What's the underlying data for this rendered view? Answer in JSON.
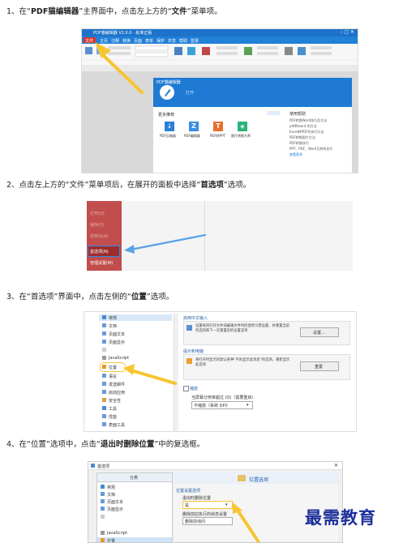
{
  "steps": [
    {
      "pre": "1、在“",
      "b1": "PDF猫编辑器",
      "mid": "”主界面中，点击左上方的“",
      "b2": "文件",
      "post": "”菜单项。"
    },
    {
      "pre": "2、点击左上方的“文件”菜单项后，在展开的面板中选择“",
      "b1": "首选项",
      "post": "”选项。"
    },
    {
      "pre": "3、在“首选项”界面中，点击左侧的“",
      "b1": "位置",
      "post": "”选项。"
    },
    {
      "pre": "4、在“位置”选项中，点击“",
      "b1": "退出时删除位置",
      "post": "”中的复选框。"
    }
  ],
  "shot1": {
    "app_title": "PDF猫编辑器 V2.0.0 · 标准正版",
    "menu": [
      "文件",
      "主页",
      "注释",
      "转换",
      "页面",
      "表单",
      "保护",
      "共享",
      "帮助",
      "登录"
    ],
    "panel_title": "PDF猫编辑器",
    "open_label": "打开",
    "more_label": "更多推荐",
    "tools": [
      "PDF压缩器",
      "PDF编辑器",
      "PDF转PPT",
      "图片转换大师"
    ],
    "tools_colors": [
      "#2b7fd8",
      "#3a8ee6",
      "#e8702a",
      "#2ab37a"
    ],
    "help_title": "使用帮助",
    "help_items": [
      "PDF转换Word技巧及方法",
      "pdf转word 的方法",
      "Excel转PDF的技巧方法",
      "PDF转换图片方法",
      "PDF转换技巧",
      "PPT、PDF、Word互转的技巧",
      "查看更多"
    ]
  },
  "shot2": {
    "items": [
      "打开(O)",
      "保存(S)",
      "另存为(A)",
      "首选项(N)",
      "管理设置(M)"
    ]
  },
  "shot3": {
    "left_items": [
      "常规",
      "文档",
      "页面文本",
      "页面显示",
      "",
      "JavaScript",
      "位置",
      "语言",
      "发送邮件",
      "启动应用",
      "安全性",
      "工具",
      "性能",
      "表面工具"
    ],
    "sec1_title": "启用中文输入",
    "sec1_text": "设置每项打开文件或编辑文件时的使用习惯设置，并重置当前所选的和下一次重置后的设置选项",
    "sec1_btn": "设置...",
    "sec2_title": "提示和电脑",
    "sec2_text": "将打开时显示的默认各种“不再显示此消息”的选项，重新显示此选项",
    "sec2_btn": "重置",
    "sec3_title": "缩放",
    "sec3_label": "当屏幕分辨率超过 (Q)（需要重启）",
    "sec3_value": "不缩放（系统 DPI）"
  },
  "shot4": {
    "title": "首选项",
    "left_header": "分类",
    "right_header": "位置选项",
    "left_items": [
      "常规",
      "文档",
      "页面文本",
      "页面显示",
      "",
      "JavaScript",
      "位置"
    ],
    "group_label": "位置设置选项",
    "exit_label": "退出时删除位置",
    "select_value": "是",
    "line2": "删除前应执行的状态设置",
    "select2_value": "删除前询问"
  },
  "watermark": "最需教育"
}
